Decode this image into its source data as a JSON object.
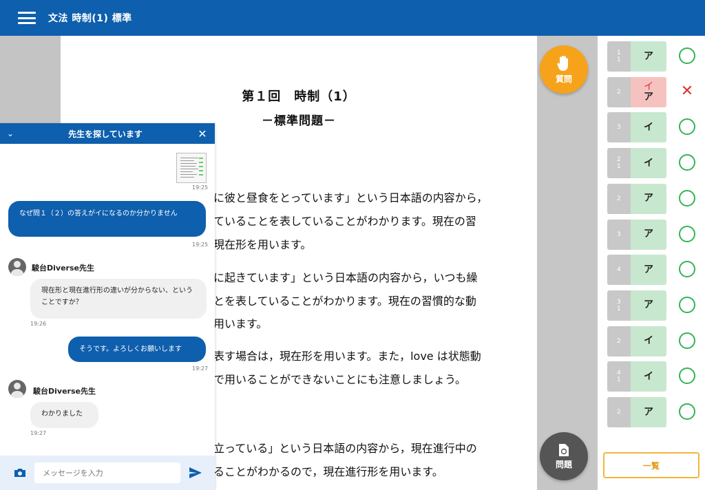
{
  "header": {
    "title": "文法 時制(1) 標準"
  },
  "document": {
    "title": "第１回　時制（1）",
    "subtitle": "－標準問題－",
    "lines": [
      "に彼と昼食をとっています」という日本語の内容から，",
      "ていることを表していることがわかります。現在の習",
      "現在形を用います。",
      "に起きています」という日本語の内容から，いつも繰",
      "とを表していることがわかります。現在の習慣的な動",
      "用います。",
      "表す場合は，現在形を用います。また，love は状態動",
      "で用いることができないことにも注意しましょう。",
      "立っている」という日本語の内容から，現在進行中の",
      "ることがわかるので，現在進行形を用います。"
    ]
  },
  "buttons": {
    "question": "質問",
    "problem": "問題",
    "list": "一覧"
  },
  "answers": [
    {
      "num": [
        "1",
        "1"
      ],
      "answer": "ア",
      "correct": true
    },
    {
      "num": [
        "2"
      ],
      "wrong": "イ",
      "answer": "ア",
      "correct": false
    },
    {
      "num": [
        "3"
      ],
      "answer": "イ",
      "correct": true
    },
    {
      "num": [
        "2",
        "1"
      ],
      "answer": "イ",
      "correct": true
    },
    {
      "num": [
        "2"
      ],
      "answer": "ア",
      "correct": true
    },
    {
      "num": [
        "3"
      ],
      "answer": "ア",
      "correct": true
    },
    {
      "num": [
        "4"
      ],
      "answer": "ア",
      "correct": true
    },
    {
      "num": [
        "3",
        "1"
      ],
      "answer": "ア",
      "correct": true
    },
    {
      "num": [
        "2"
      ],
      "answer": "イ",
      "correct": true
    },
    {
      "num": [
        "4",
        "1"
      ],
      "answer": "イ",
      "correct": true
    },
    {
      "num": [
        "2"
      ],
      "answer": "ア",
      "correct": true
    }
  ],
  "chat": {
    "title": "先生を探しています",
    "messages": {
      "image_time": "19:25",
      "q_text": "なぜ問１（２）の答えがイになるのか分かりません",
      "q_time": "19:25",
      "teacher_name": "駿台Diverse先生",
      "t1_text": "現在形と現在進行形の違いが分からない、ということですか？",
      "t1_time": "19:26",
      "me2_text": "そうです。よろしくお願いします",
      "me2_time": "19:27",
      "teacher_name2": "駿台Diverse先生",
      "t2_text": "わかりました",
      "t2_time": "19:27"
    },
    "input_placeholder": "メッセージを入力"
  },
  "colors": {
    "primary": "#0e5fad",
    "question": "#f6a31b",
    "correct": "#33b355",
    "wrong": "#e23030"
  },
  "icons": [
    "menu-icon",
    "hand-icon",
    "refresh-doc-icon",
    "chevron-down-icon",
    "close-icon",
    "camera-icon",
    "send-icon",
    "user-icon",
    "check-circle-icon",
    "cross-icon"
  ]
}
